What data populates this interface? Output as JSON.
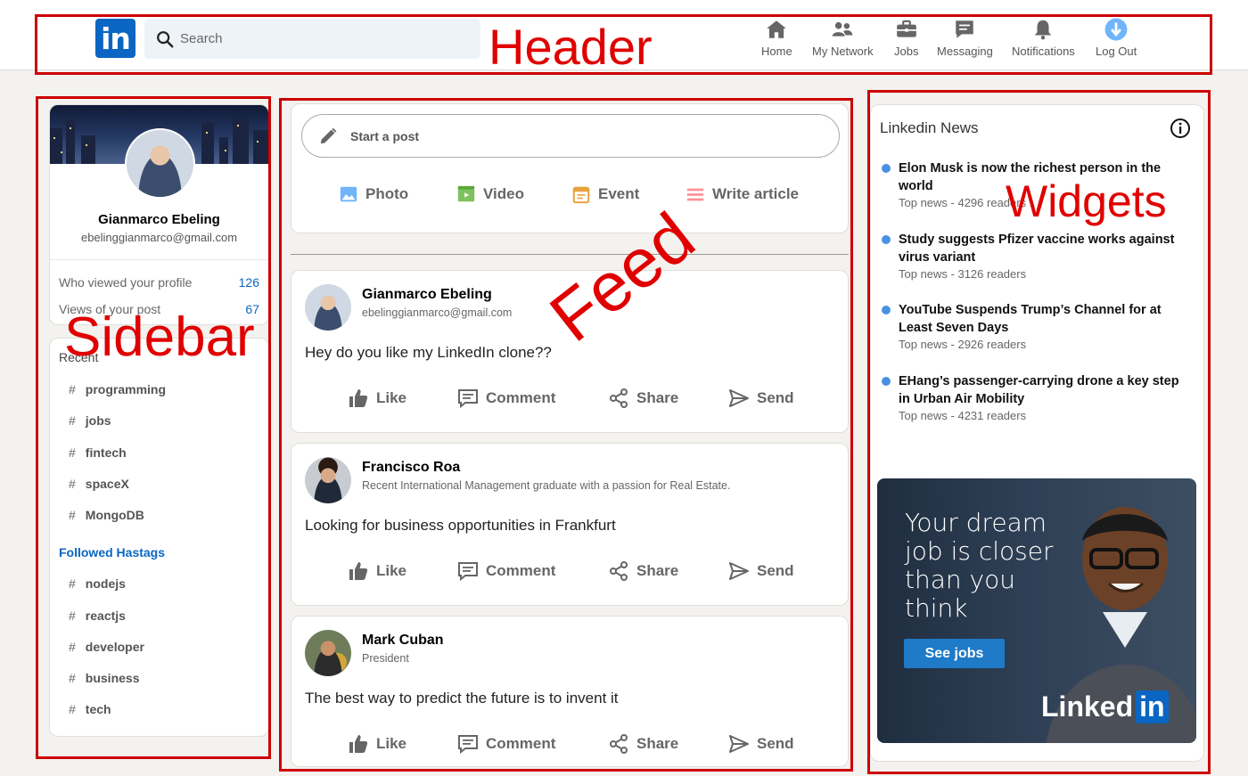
{
  "header": {
    "logo": "in",
    "search_placeholder": "Search",
    "nav": [
      {
        "label": "Home",
        "icon": "home-icon"
      },
      {
        "label": "My Network",
        "icon": "network-icon"
      },
      {
        "label": "Jobs",
        "icon": "jobs-icon"
      },
      {
        "label": "Messaging",
        "icon": "messaging-icon"
      },
      {
        "label": "Notifications",
        "icon": "notifications-icon"
      },
      {
        "label": "Log Out",
        "icon": "logout-icon"
      }
    ]
  },
  "annotations": {
    "header": "Header",
    "sidebar": "Sidebar",
    "feed": "Feed",
    "widgets": "Widgets"
  },
  "sidebar": {
    "name": "Gianmarco Ebeling",
    "email": "ebelinggianmarco@gmail.com",
    "stats": [
      {
        "label": "Who viewed your profile",
        "value": "126"
      },
      {
        "label": "Views of your post",
        "value": "67"
      }
    ],
    "recent_heading": "Recent",
    "recent": [
      "programming",
      "jobs",
      "fintech",
      "spaceX",
      "MongoDB"
    ],
    "followed_heading": "Followed Hastags",
    "followed": [
      "nodejs",
      "reactjs",
      "developer",
      "business",
      "tech"
    ],
    "hash": "#"
  },
  "share": {
    "placeholder": "Start a post",
    "options": [
      {
        "label": "Photo",
        "icon": "photo-icon",
        "color": "#70b5f9"
      },
      {
        "label": "Video",
        "icon": "video-icon",
        "color": "#7fc15e"
      },
      {
        "label": "Event",
        "icon": "event-icon",
        "color": "#e7a33e"
      },
      {
        "label": "Write article",
        "icon": "article-icon",
        "color": "#fc9295"
      }
    ]
  },
  "posts": [
    {
      "name": "Gianmarco Ebeling",
      "sub": "ebelinggianmarco@gmail.com",
      "message": "Hey do you like my LinkedIn clone??"
    },
    {
      "name": "Francisco Roa",
      "sub": "Recent International Management graduate with a passion for Real Estate.",
      "message": "Looking for business opportunities in Frankfurt"
    },
    {
      "name": "Mark Cuban",
      "sub": "President",
      "message": "The best way to predict the future is to invent it"
    }
  ],
  "post_actions": [
    "Like",
    "Comment",
    "Share",
    "Send"
  ],
  "widgets": {
    "title": "Linkedin News",
    "news": [
      {
        "headline": "Elon Musk is now the richest person in the world",
        "meta": "Top news - 4296 readers"
      },
      {
        "headline": "Study suggests Pfizer vaccine works against virus variant",
        "meta": "Top news - 3126 readers"
      },
      {
        "headline": "YouTube Suspends Trump’s Channel for at Least Seven Days",
        "meta": "Top news - 2926 readers"
      },
      {
        "headline": "EHang’s passenger-carrying drone a key step in Urban Air Mobility",
        "meta": "Top news - 4231 readers"
      }
    ],
    "ad": {
      "lines": [
        "Your dream",
        "job is closer",
        "than you",
        "think"
      ],
      "button": "See jobs",
      "brand_text": "Linked",
      "brand_in": "in"
    }
  },
  "colors": {
    "accent": "#0a66c2",
    "annotation": "#cc0000"
  }
}
